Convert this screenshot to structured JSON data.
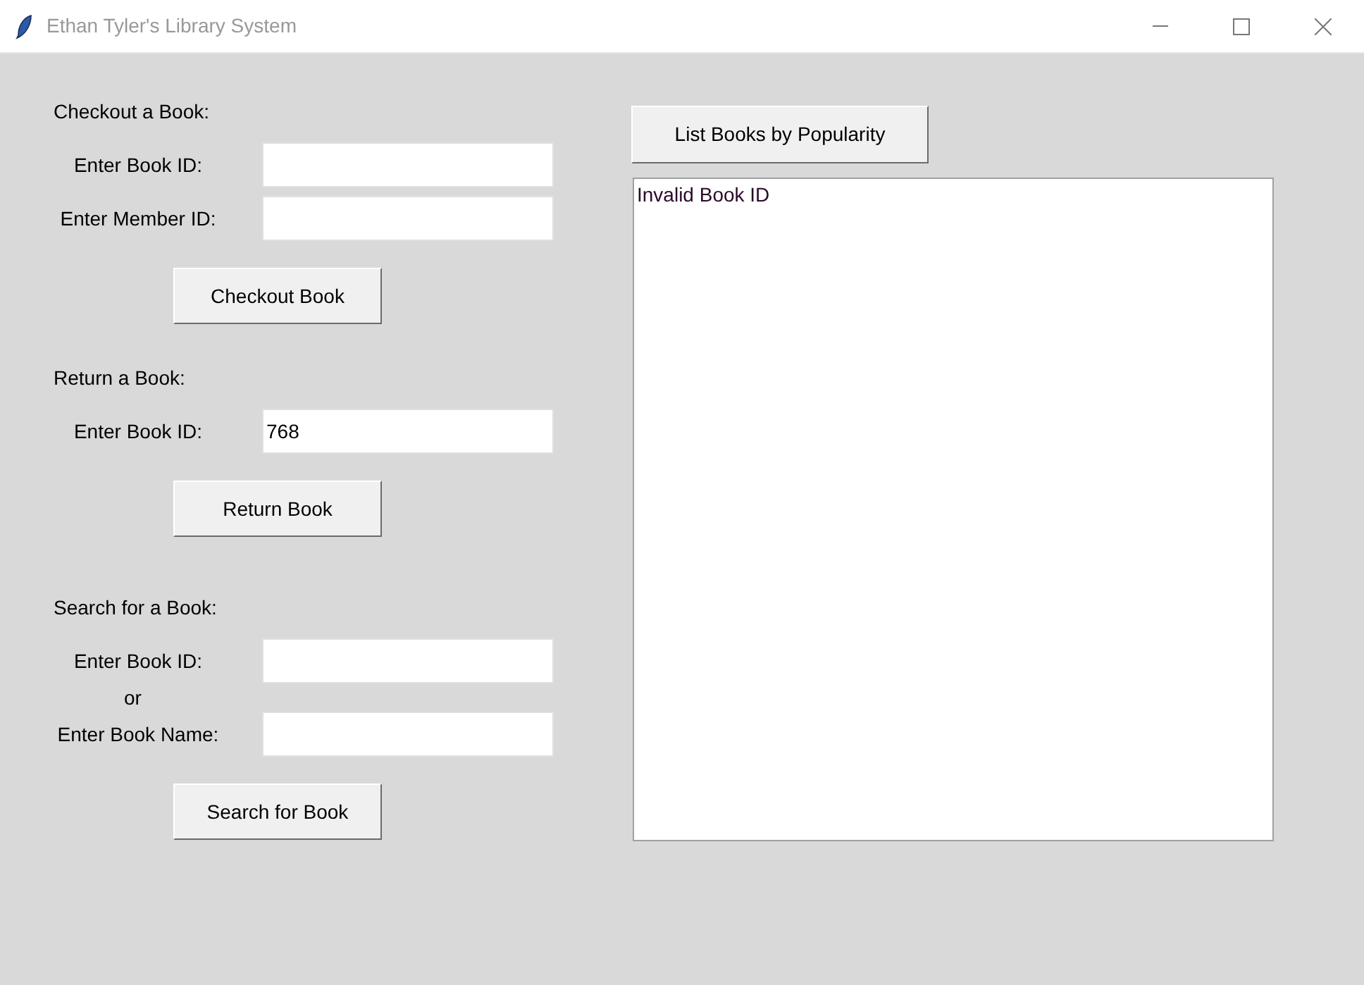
{
  "window": {
    "title": "Ethan Tyler's Library System"
  },
  "sections": [
    {
      "heading": "Checkout a Book:",
      "rows": [
        {
          "kind": "field",
          "label": "Enter Book ID:"
        },
        {
          "kind": "field",
          "label": "Enter Member ID:"
        }
      ],
      "button": "Checkout Book"
    },
    {
      "heading": "Return a Book:",
      "rows": [
        {
          "kind": "field",
          "label": "Enter Book ID:",
          "value": "768"
        }
      ],
      "button": "Return Book"
    },
    {
      "heading": "Search for a Book:",
      "rows": [
        {
          "kind": "field",
          "label": "Enter Book ID:"
        },
        {
          "kind": "note",
          "text": "or"
        },
        {
          "kind": "field",
          "label": "Enter Book Name:"
        }
      ],
      "button": "Search for Book"
    }
  ],
  "list_button": "List Books by Popularity",
  "output": {
    "lines": [
      "Invalid Book ID"
    ]
  }
}
